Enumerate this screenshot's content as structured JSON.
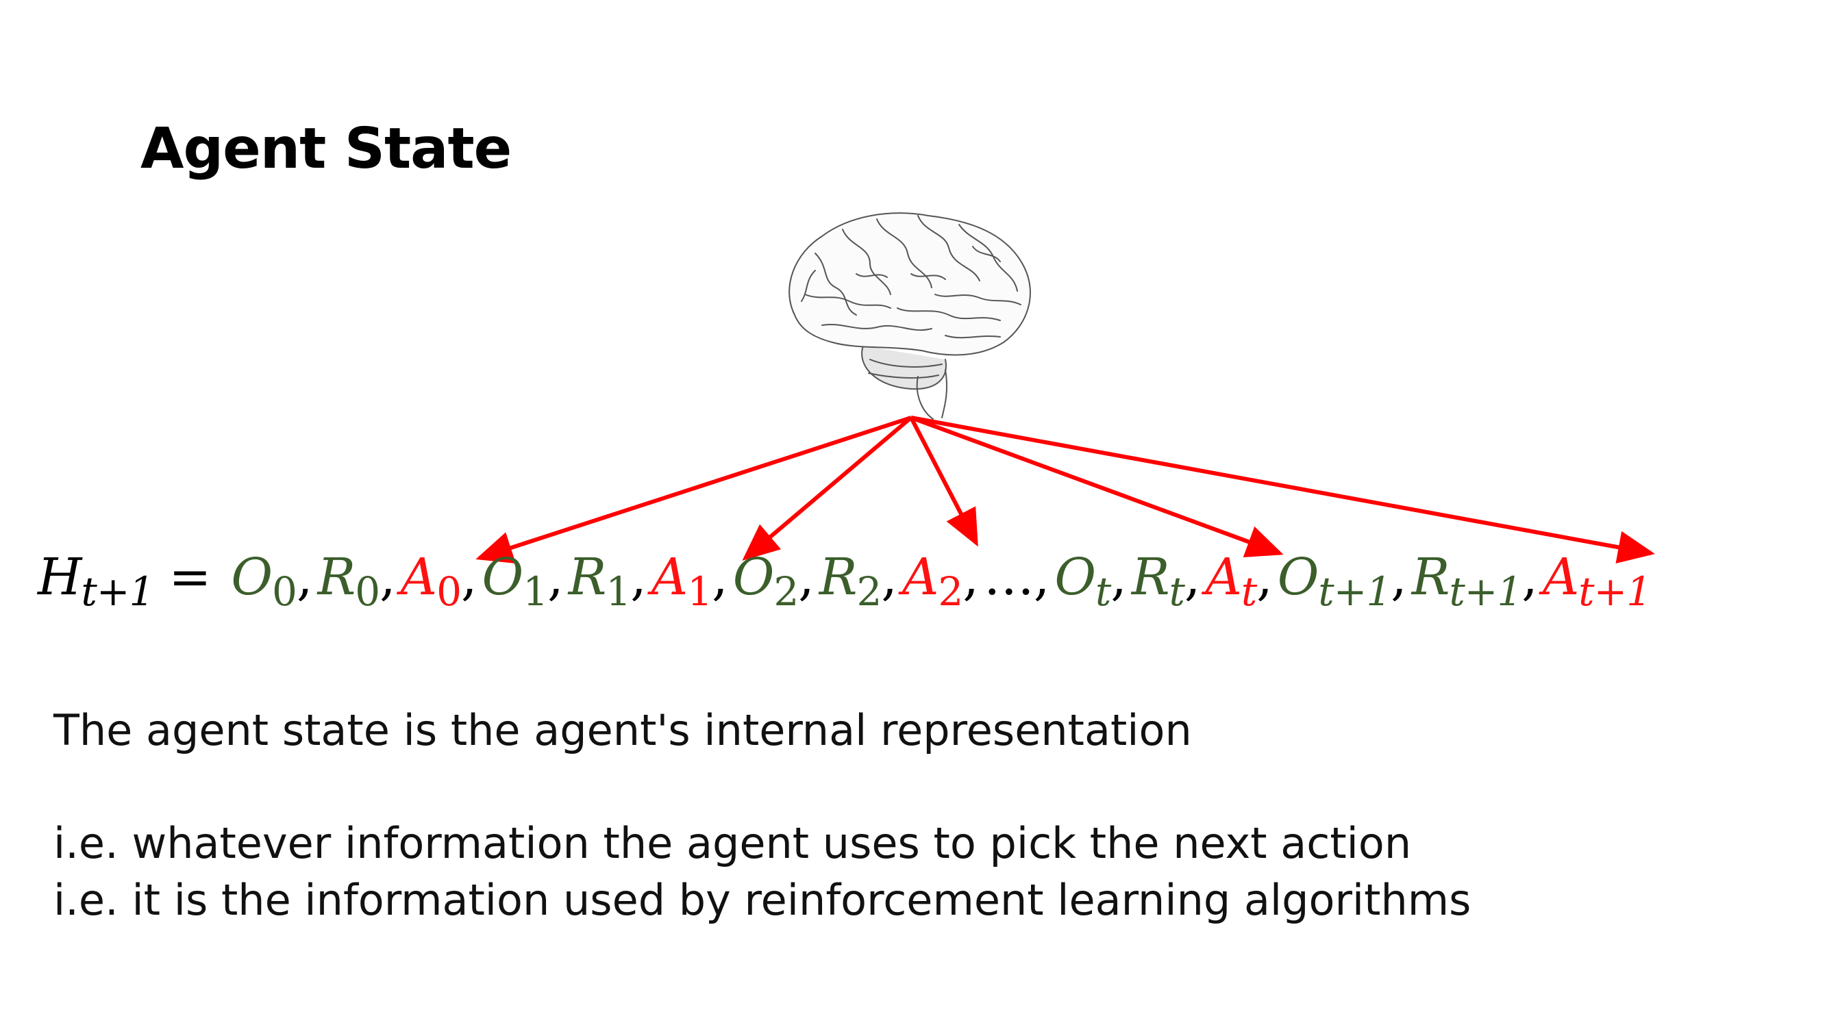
{
  "slide": {
    "title": "Agent State",
    "formula": {
      "lhs": {
        "symbol": "H",
        "subscript": "t+1",
        "color": "#000000"
      },
      "equals": "=",
      "terms": [
        {
          "symbol": "O",
          "subscript": "0",
          "color": "#3b5e2b",
          "sep": ","
        },
        {
          "symbol": "R",
          "subscript": "0",
          "color": "#3b5e2b",
          "sep": ","
        },
        {
          "symbol": "A",
          "subscript": "0",
          "color": "#ff1111",
          "sep": ","
        },
        {
          "symbol": "O",
          "subscript": "1",
          "color": "#3b5e2b",
          "sep": ","
        },
        {
          "symbol": "R",
          "subscript": "1",
          "color": "#3b5e2b",
          "sep": ","
        },
        {
          "symbol": "A",
          "subscript": "1",
          "color": "#ff1111",
          "sep": ","
        },
        {
          "symbol": "O",
          "subscript": "2",
          "color": "#3b5e2b",
          "sep": ","
        },
        {
          "symbol": "R",
          "subscript": "2",
          "color": "#3b5e2b",
          "sep": ","
        },
        {
          "symbol": "A",
          "subscript": "2",
          "color": "#ff1111",
          "sep": ","
        },
        {
          "symbol": "…",
          "subscript": "",
          "color": "#000000",
          "sep": ","
        },
        {
          "symbol": "O",
          "subscript": "t",
          "color": "#3b5e2b",
          "sep": ","
        },
        {
          "symbol": "R",
          "subscript": "t",
          "color": "#3b5e2b",
          "sep": ","
        },
        {
          "symbol": "A",
          "subscript": "t",
          "color": "#ff1111",
          "sep": ","
        },
        {
          "symbol": "O",
          "subscript": "t+1",
          "color": "#3b5e2b",
          "sep": ","
        },
        {
          "symbol": "R",
          "subscript": "t+1",
          "color": "#3b5e2b",
          "sep": ","
        },
        {
          "symbol": "A",
          "subscript": "t+1",
          "color": "#ff1111",
          "sep": ""
        }
      ]
    },
    "lines": [
      "The agent state is the agent's internal representation",
      "i.e. whatever information the agent uses to pick the next action",
      "i.e. it is the information used by reinforcement learning algorithms"
    ],
    "colors": {
      "observation_reward": "#3b5e2b",
      "action": "#ff1111",
      "arrow": "#ff0000"
    },
    "icons": {
      "brain": "brain-icon"
    }
  }
}
